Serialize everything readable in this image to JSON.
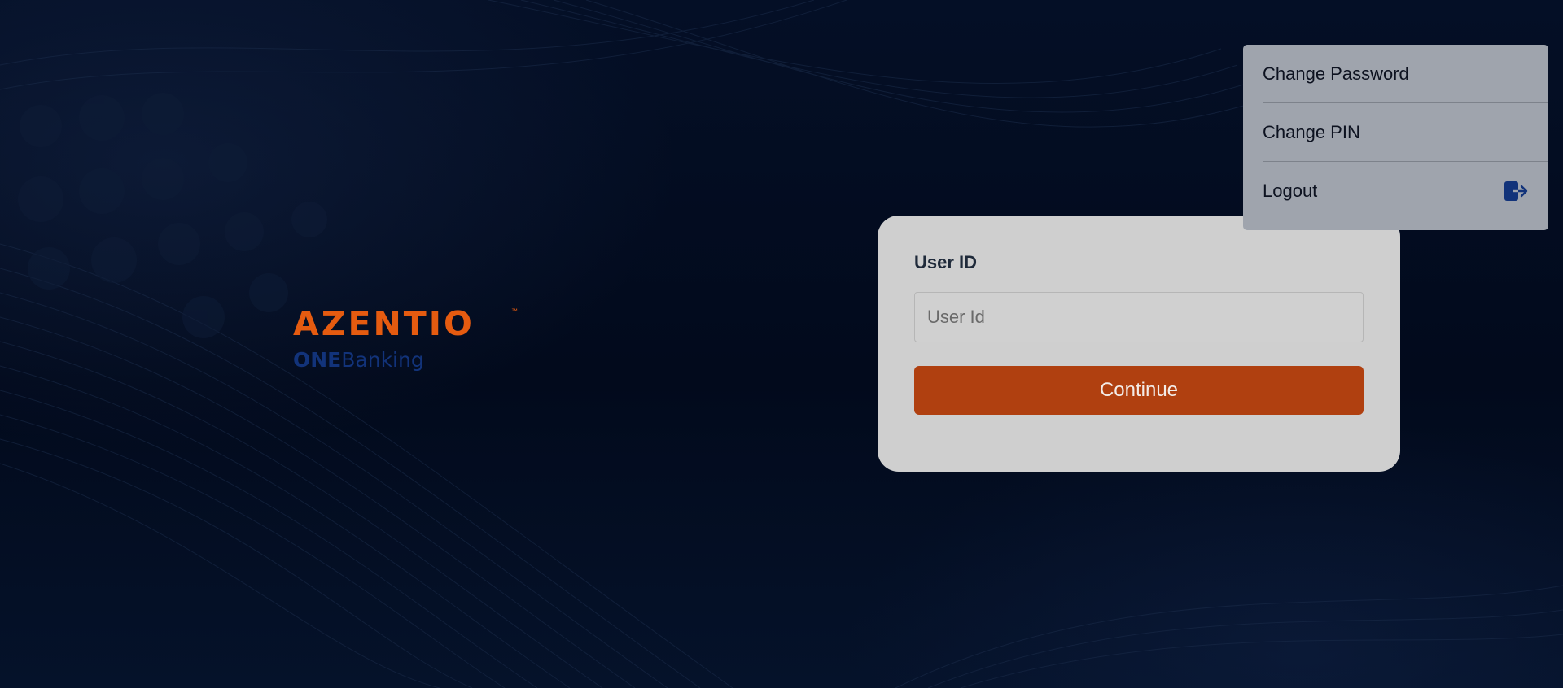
{
  "brand": {
    "name": "AZENTIO",
    "trademark": "™",
    "product_bold": "ONE",
    "product_light": "Banking"
  },
  "login": {
    "user_id_label": "User ID",
    "user_id_placeholder": "User Id",
    "user_id_value": "",
    "continue_label": "Continue"
  },
  "menu": {
    "items": [
      {
        "label": "Change Password",
        "icon": null
      },
      {
        "label": "Change PIN",
        "icon": null
      },
      {
        "label": "Logout",
        "icon": "logout-icon"
      }
    ]
  },
  "colors": {
    "background": "#030d22",
    "brand_orange": "#e55b10",
    "brand_blue": "#12337a",
    "button": "#b04010",
    "card": "#cfcfcf",
    "menu": "#9fa4ad",
    "logout_icon": "#12337a"
  }
}
